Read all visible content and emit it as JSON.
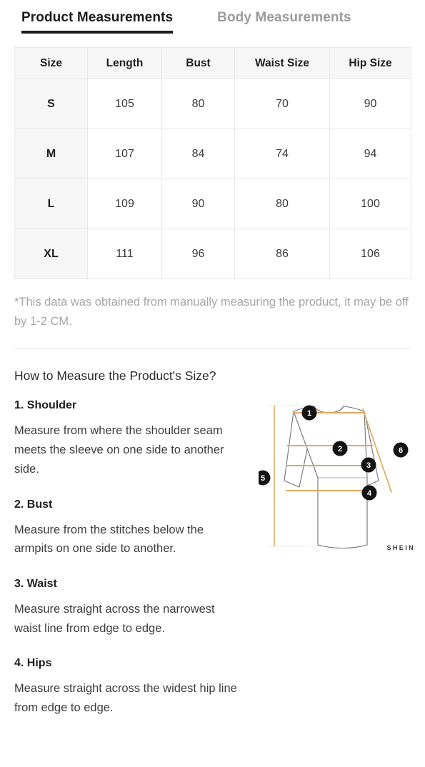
{
  "tabs": [
    {
      "label": "Product Measurements",
      "active": true
    },
    {
      "label": "Body Measurements",
      "active": false
    }
  ],
  "table": {
    "headers": [
      "Size",
      "Length",
      "Bust",
      "Waist Size",
      "Hip Size"
    ],
    "rows": [
      {
        "size": "S",
        "length": "105",
        "bust": "80",
        "waist": "70",
        "hip": "90"
      },
      {
        "size": "M",
        "length": "107",
        "bust": "84",
        "waist": "74",
        "hip": "94"
      },
      {
        "size": "L",
        "length": "109",
        "bust": "90",
        "waist": "80",
        "hip": "100"
      },
      {
        "size": "XL",
        "length": "111",
        "bust": "96",
        "waist": "86",
        "hip": "106"
      }
    ]
  },
  "disclaimer": "*This data was obtained from manually measuring the product, it may be off by 1-2 CM.",
  "how_to_measure": {
    "heading": "How to Measure the Product's Size?",
    "steps": [
      {
        "title": "1. Shoulder",
        "description": "Measure from where the shoulder seam meets the sleeve on one side to another side."
      },
      {
        "title": "2. Bust",
        "description": "Measure from the stitches below the armpits on one side to another."
      },
      {
        "title": "3. Waist",
        "description": "Measure straight across the narrowest waist line from edge to edge."
      },
      {
        "title": "4. Hips",
        "description": "Measure straight across the widest hip line from edge to edge."
      }
    ]
  },
  "diagram": {
    "markers": [
      "1",
      "2",
      "3",
      "4",
      "5",
      "6"
    ],
    "watermark": "SHEIN",
    "colors": {
      "measure_line": "#e0a95c",
      "garment_outline": "#6b6f78",
      "marker_fill": "#1a1a1a",
      "guide_line": "#d9d9d9"
    }
  },
  "colors": {
    "active_tab": "#1c1c1c",
    "inactive_tab": "#9b9b9b",
    "header_bg": "#f6f6f6",
    "border": "#e8e8e8",
    "muted_text": "#a6a6a6"
  }
}
